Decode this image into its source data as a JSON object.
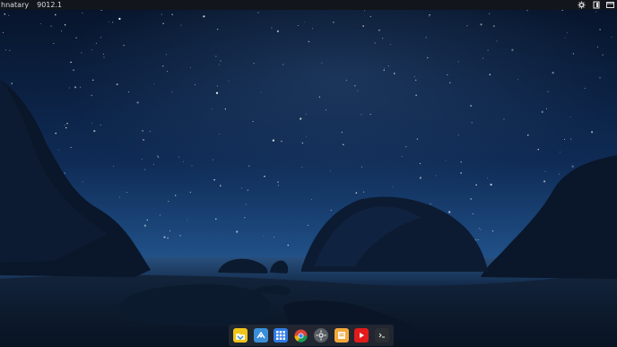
{
  "topbar": {
    "app_name": "hnatary",
    "clock": "9012.1",
    "icons": [
      "settings-icon",
      "battery-icon",
      "window-icon"
    ]
  },
  "wallpaper": {
    "description_icon": "night-sky-wallpaper"
  },
  "dock": {
    "items": [
      {
        "name": "files-app",
        "icon": "folder-icon",
        "color": "#f0c419"
      },
      {
        "name": "finder-app",
        "icon": "finder-icon",
        "color": "#3a8fd9"
      },
      {
        "name": "app-grid",
        "icon": "grid-icon",
        "color": "#2f7be6"
      },
      {
        "name": "chrome-app",
        "icon": "chrome-icon",
        "color": "#dd4b39"
      },
      {
        "name": "settings-app",
        "icon": "gear-icon",
        "color": "#5a5f66"
      },
      {
        "name": "notes-app",
        "icon": "notes-icon",
        "color": "#f2a93b"
      },
      {
        "name": "youtube-app",
        "icon": "play-icon",
        "color": "#e21b1b"
      },
      {
        "name": "terminal-app",
        "icon": "terminal-icon",
        "color": "#2b2e33"
      }
    ]
  }
}
